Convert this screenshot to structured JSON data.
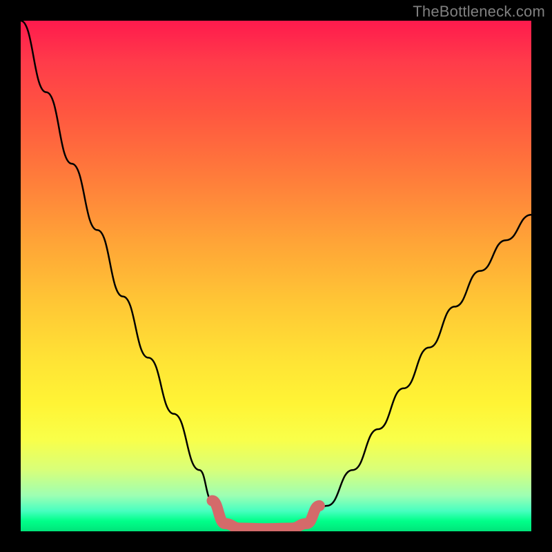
{
  "watermark": "TheBottleneck.com",
  "chart_data": {
    "type": "line",
    "title": "",
    "xlabel": "",
    "ylabel": "",
    "xlim": [
      0,
      1
    ],
    "ylim": [
      0,
      1
    ],
    "series": [
      {
        "name": "left-curve",
        "x": [
          0.0,
          0.05,
          0.1,
          0.15,
          0.2,
          0.25,
          0.3,
          0.35,
          0.375,
          0.4
        ],
        "y": [
          1.0,
          0.86,
          0.72,
          0.59,
          0.46,
          0.34,
          0.23,
          0.12,
          0.06,
          0.015
        ]
      },
      {
        "name": "valley-floor",
        "x": [
          0.4,
          0.43,
          0.48,
          0.53,
          0.56
        ],
        "y": [
          0.015,
          0.006,
          0.005,
          0.006,
          0.015
        ]
      },
      {
        "name": "right-curve",
        "x": [
          0.56,
          0.6,
          0.65,
          0.7,
          0.75,
          0.8,
          0.85,
          0.9,
          0.95,
          1.0
        ],
        "y": [
          0.015,
          0.05,
          0.12,
          0.2,
          0.28,
          0.36,
          0.44,
          0.51,
          0.57,
          0.62
        ]
      }
    ],
    "highlight": {
      "name": "optimal-zone",
      "color": "#d46a6a",
      "x": [
        0.375,
        0.4,
        0.43,
        0.48,
        0.53,
        0.56,
        0.585
      ],
      "y": [
        0.06,
        0.015,
        0.006,
        0.005,
        0.006,
        0.015,
        0.05
      ]
    },
    "gradient_stops": [
      {
        "pos": 0.0,
        "color": "#ff1a4d"
      },
      {
        "pos": 0.3,
        "color": "#ff7a3b"
      },
      {
        "pos": 0.55,
        "color": "#ffc635"
      },
      {
        "pos": 0.8,
        "color": "#f9ff49"
      },
      {
        "pos": 1.0,
        "color": "#00e47a"
      }
    ]
  }
}
